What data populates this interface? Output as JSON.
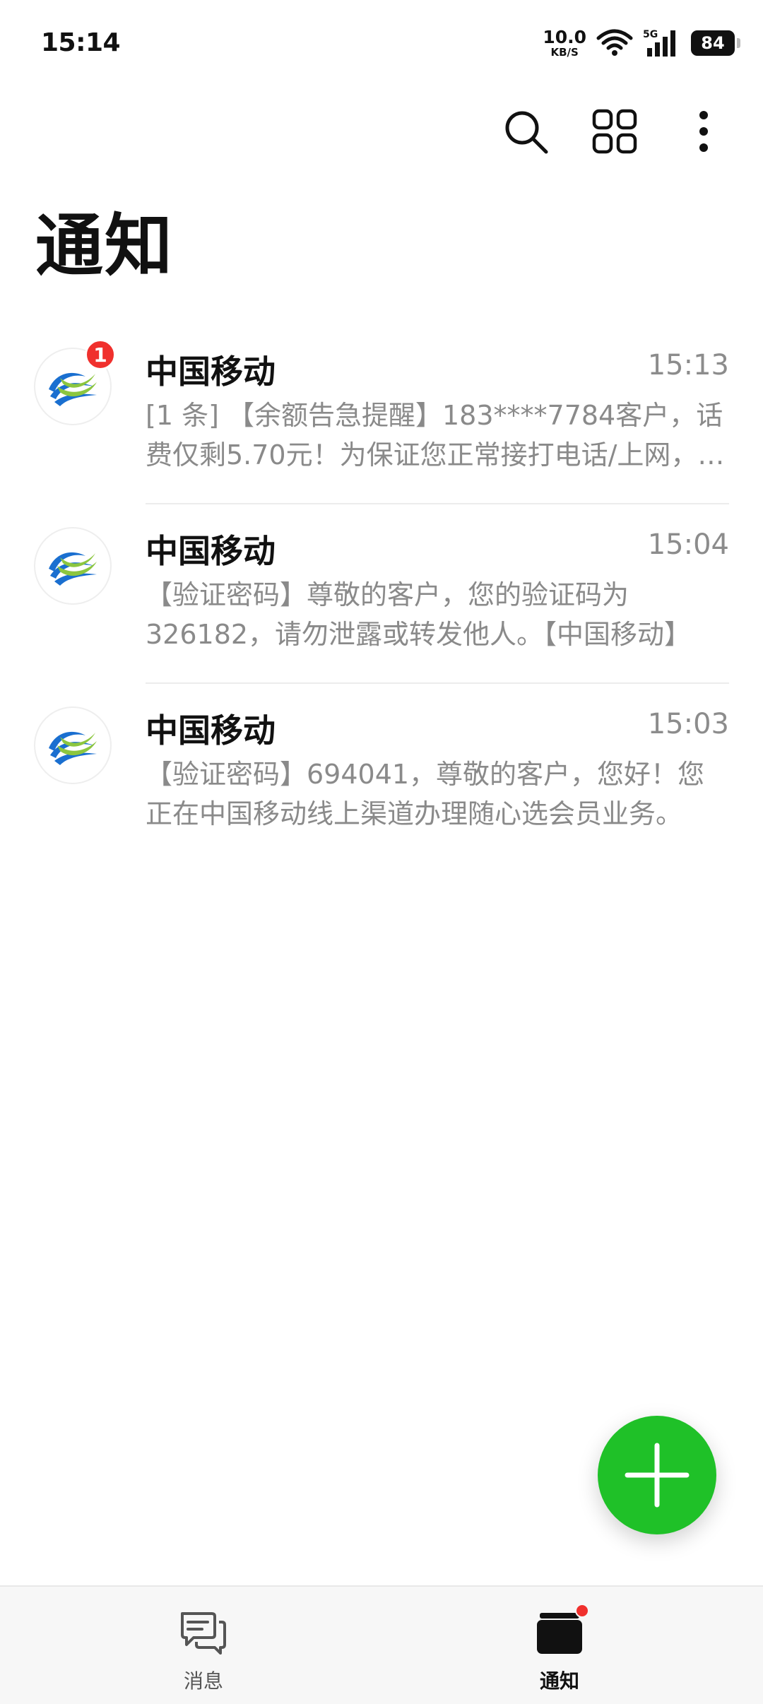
{
  "status_bar": {
    "time": "15:14",
    "net_speed_value": "10.0",
    "net_speed_unit": "KB/S",
    "network_type": "5G",
    "battery": "84"
  },
  "toolbar": {
    "search_icon": "search-icon",
    "grid_icon": "grid-icon",
    "more_icon": "more-vertical-icon"
  },
  "page_title": "通知",
  "messages": [
    {
      "sender": "中国移动",
      "time": "15:13",
      "preview": "[1 条] 【余额告急提醒】183****7784客户，话费仅剩5.70元！为保证您正常接打电话/上网，请及时充值。",
      "unread_count": "1"
    },
    {
      "sender": "中国移动",
      "time": "15:04",
      "preview": "【验证密码】尊敬的客户，您的验证码为326182，请勿泄露或转发他人。【中国移动】"
    },
    {
      "sender": "中国移动",
      "time": "15:03",
      "preview": "【验证密码】694041，尊敬的客户，您好！您正在中国移动线上渠道办理随心选会员业务。"
    }
  ],
  "fab": {
    "icon": "plus-icon"
  },
  "bottom_nav": [
    {
      "label": "消息",
      "icon": "chat-bubble-icon",
      "active": false
    },
    {
      "label": "通知",
      "icon": "notification-box-icon",
      "active": true,
      "has_dot": true
    }
  ],
  "colors": {
    "accent_green": "#1fc128",
    "badge_red": "#f0302d",
    "logo_blue": "#1a6fd0",
    "logo_green": "#8cc63f",
    "text_secondary": "#8a8a8a"
  }
}
